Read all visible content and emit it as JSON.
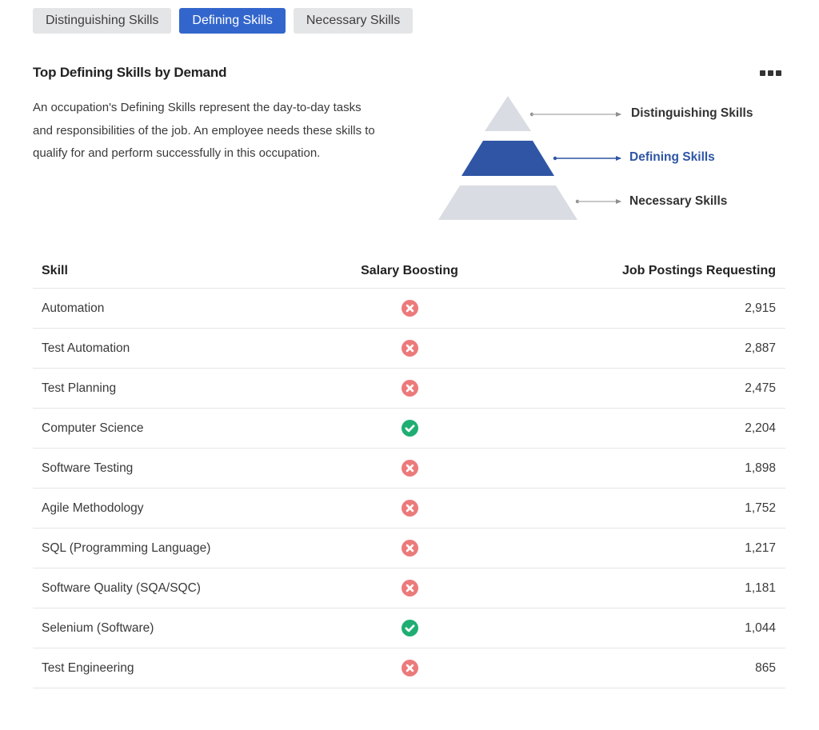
{
  "tabs": [
    {
      "label": "Distinguishing Skills",
      "active": false
    },
    {
      "label": "Defining Skills",
      "active": true
    },
    {
      "label": "Necessary Skills",
      "active": false
    }
  ],
  "section": {
    "title": "Top Defining Skills by Demand",
    "description": "An occupation's Defining Skills represent the day-to-day tasks and responsibilities of the job. An employee needs these skills to qualify for and perform successfully in this occupation."
  },
  "pyramid": {
    "top_label": "Distinguishing Skills",
    "middle_label": "Defining Skills",
    "bottom_label": "Necessary Skills",
    "active_color": "#2f55a4",
    "inactive_color": "#d9dce2"
  },
  "table": {
    "headers": {
      "skill": "Skill",
      "salary": "Salary Boosting",
      "jobs": "Job Postings Requesting"
    },
    "rows": [
      {
        "skill": "Automation",
        "salary_boosting": false,
        "jobs": "2,915"
      },
      {
        "skill": "Test Automation",
        "salary_boosting": false,
        "jobs": "2,887"
      },
      {
        "skill": "Test Planning",
        "salary_boosting": false,
        "jobs": "2,475"
      },
      {
        "skill": "Computer Science",
        "salary_boosting": true,
        "jobs": "2,204"
      },
      {
        "skill": "Software Testing",
        "salary_boosting": false,
        "jobs": "1,898"
      },
      {
        "skill": "Agile Methodology",
        "salary_boosting": false,
        "jobs": "1,752"
      },
      {
        "skill": "SQL (Programming Language)",
        "salary_boosting": false,
        "jobs": "1,217"
      },
      {
        "skill": "Software Quality (SQA/SQC)",
        "salary_boosting": false,
        "jobs": "1,181"
      },
      {
        "skill": "Selenium (Software)",
        "salary_boosting": true,
        "jobs": "1,044"
      },
      {
        "skill": "Test Engineering",
        "salary_boosting": false,
        "jobs": "865"
      }
    ]
  },
  "icons": {
    "yes": "check-circle-icon",
    "no": "x-circle-icon",
    "yes_color": "#1fae72",
    "no_color": "#ec7a7a"
  }
}
